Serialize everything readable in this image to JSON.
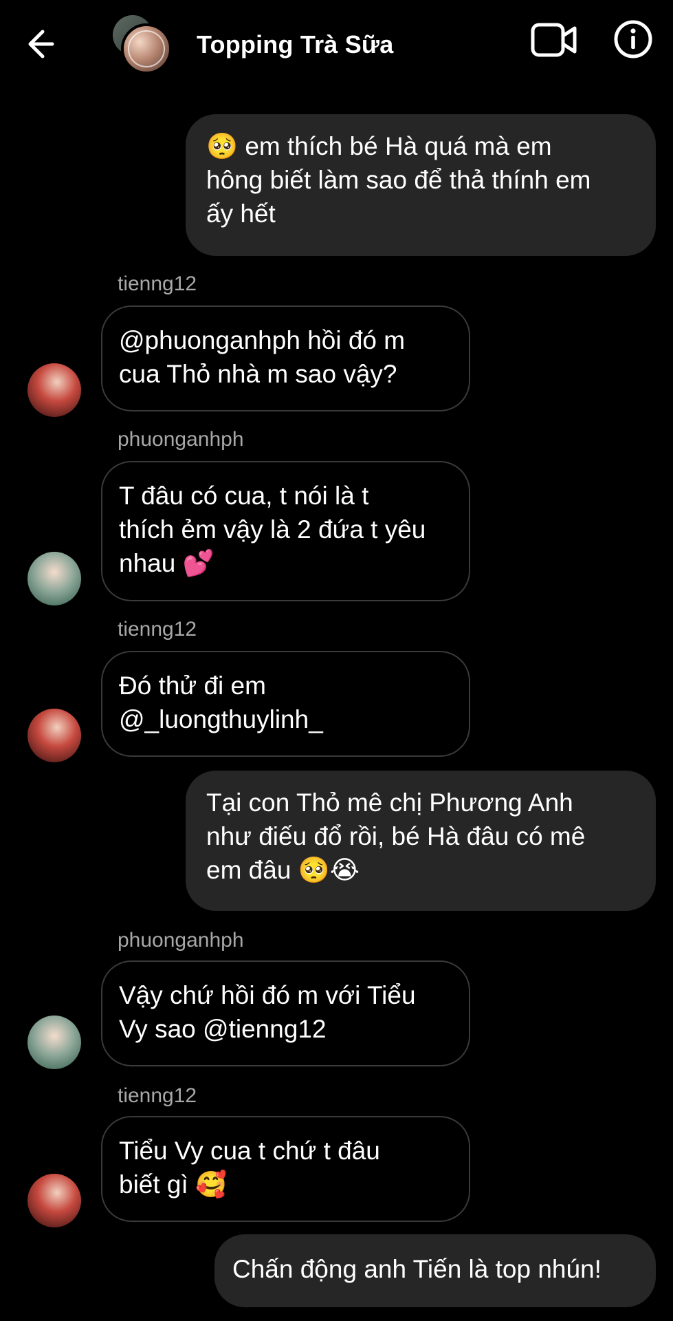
{
  "header": {
    "title": "Topping Trà Sữa"
  },
  "messages": [
    {
      "type": "outgoing",
      "text": "🥺 em thích bé Hà quá mà em\nhông biết làm sao để thả thính em\nấy hết"
    },
    {
      "type": "incoming",
      "sender": "tienng12",
      "text": "@phuonganhph hồi đó m\ncua Thỏ nhà m sao vậy?"
    },
    {
      "type": "incoming",
      "sender": "phuonganhph",
      "text": "T đâu có cua, t nói là t\nthích ẻm vậy là 2 đứa t yêu\nnhau 💕"
    },
    {
      "type": "incoming",
      "sender": "tienng12",
      "text": "Đó thử đi em\n@_luongthuylinh_"
    },
    {
      "type": "outgoing",
      "text": "Tại con Thỏ mê chị Phương Anh\nnhư điếu đổ rồi, bé Hà đâu có mê\nem đâu 🥺😭"
    },
    {
      "type": "incoming",
      "sender": "phuonganhph",
      "text": "Vậy chứ hồi đó m với Tiểu\nVy sao @tienng12"
    },
    {
      "type": "incoming",
      "sender": "tienng12",
      "text": "Tiểu Vy cua t chứ t đâu\nbiết gì 🥰"
    },
    {
      "type": "outgoing",
      "text": "Chấn động anh Tiến là top nhún!"
    }
  ],
  "colors": {
    "background": "#000000",
    "outgoing_bubble": "#262626",
    "incoming_border": "#3a3a3a",
    "sender_label": "#a8a8a8",
    "text": "#ffffff"
  },
  "icons": {
    "back": "arrow-left-icon",
    "video": "video-camera-icon",
    "info": "info-circle-icon"
  }
}
